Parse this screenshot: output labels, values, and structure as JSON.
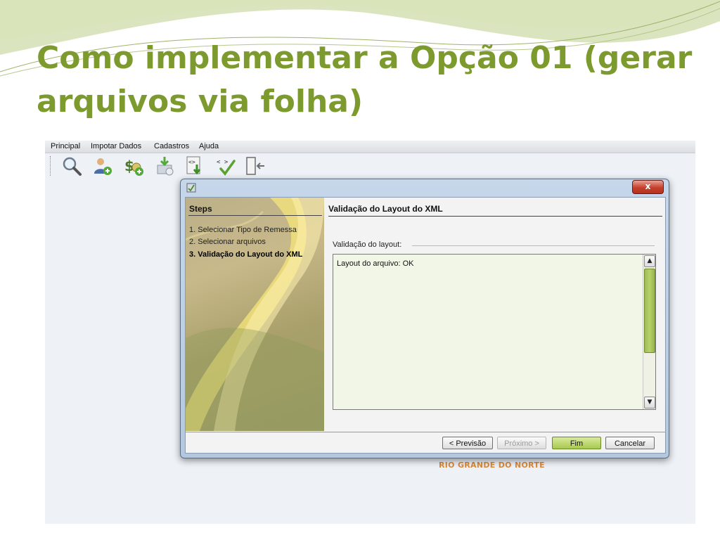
{
  "slide": {
    "title": "Como implementar a Opção 01 (gerar arquivos via folha)"
  },
  "menu": {
    "items": [
      "Principal",
      "Impotar Dados",
      "Cadastros",
      "Ajuda"
    ]
  },
  "toolbar": {
    "icons": [
      "search-icon",
      "user-add-icon",
      "money-add-icon",
      "download-icon",
      "import-xml-icon",
      "validate-xml-icon",
      "exit-icon"
    ]
  },
  "dialog": {
    "steps_title": "Steps",
    "steps": [
      "1. Selecionar Tipo de Remessa",
      "2. Selecionar arquivos",
      "3. Validação do Layout do XML"
    ],
    "current_step": 3,
    "content_title": "Validação do Layout do XML",
    "group_label": "Validação do layout:",
    "result_text": "Layout do arquivo: OK",
    "close_label": "x",
    "buttons": {
      "previous": "< Previsão",
      "next": "Próximo >",
      "finish": "Fim",
      "cancel": "Cancelar"
    }
  },
  "background": {
    "org_text": "RIO GRANDE DO NORTE"
  },
  "colors": {
    "title": "#7d9a2e",
    "accent_green": "#a8c94e",
    "close_red": "#c4402c",
    "org_orange": "#d98a3a"
  }
}
